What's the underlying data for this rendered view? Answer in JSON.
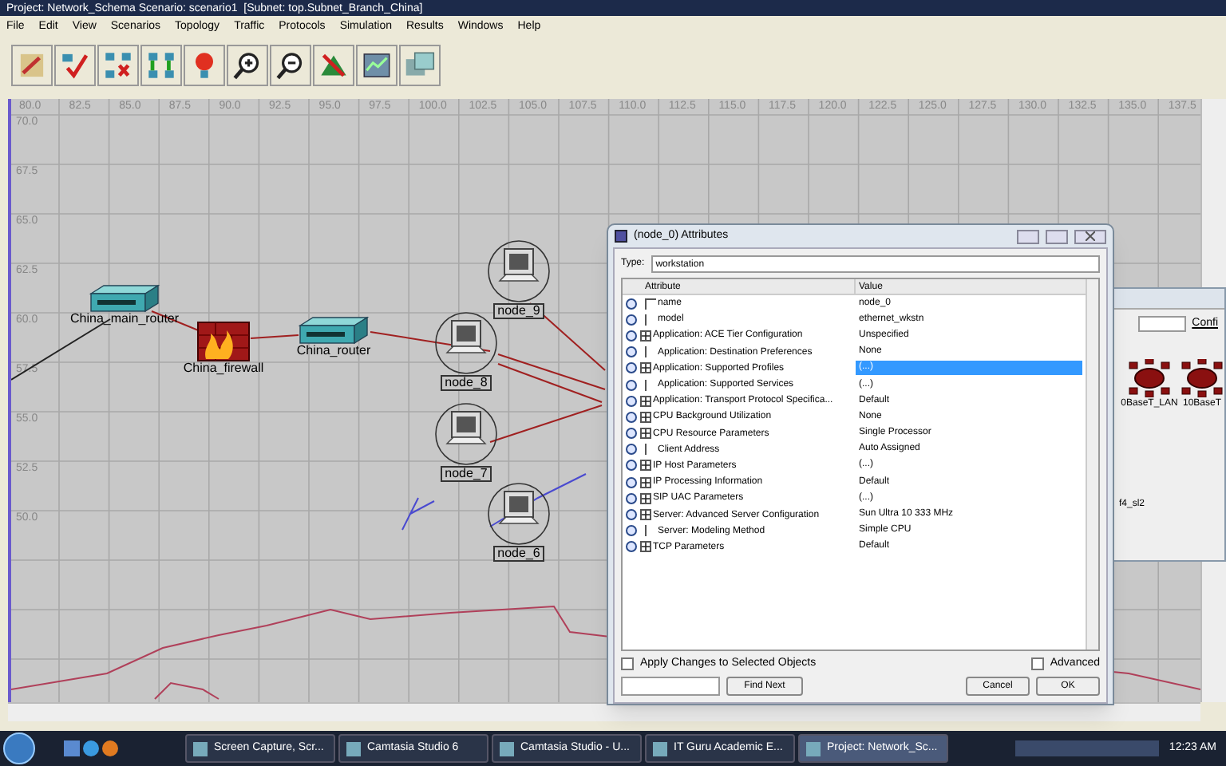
{
  "window": {
    "title": "Project: Network_Schema Scenario: scenario1  [Subnet: top.Subnet_Branch_China]"
  },
  "menu": [
    "File",
    "Edit",
    "View",
    "Scenarios",
    "Topology",
    "Traffic",
    "Protocols",
    "Simulation",
    "Results",
    "Windows",
    "Help"
  ],
  "toolbar": [
    {
      "kind": "palette"
    },
    {
      "kind": "check"
    },
    {
      "kind": "fail"
    },
    {
      "kind": "recover"
    },
    {
      "kind": "bulb"
    },
    {
      "kind": "zoom"
    },
    {
      "kind": "unzoom"
    },
    {
      "kind": "run"
    },
    {
      "kind": "results"
    },
    {
      "kind": "web"
    }
  ],
  "canvas": {
    "x_ruler": [
      "80.0",
      "82.5",
      "85.0",
      "87.5",
      "90.0",
      "92.5",
      "95.0",
      "97.5",
      "100.0",
      "102.5",
      "105.0",
      "107.5",
      "110.0",
      "112.5",
      "115.0",
      "117.5",
      "120.0",
      "122.5",
      "125.0",
      "127.5",
      "130.0",
      "132.5",
      "135.0",
      "137.5"
    ],
    "y_ruler": [
      "70.0",
      "67.5",
      "65.0",
      "62.5",
      "60.0",
      "57.5",
      "55.0",
      "52.5",
      "50.0"
    ],
    "nodes": [
      {
        "kind": "router",
        "label": "China_main_router"
      },
      {
        "kind": "firewall",
        "label": "China_firewall"
      },
      {
        "kind": "router",
        "label": "China_router"
      },
      {
        "kind": "workstation",
        "label": "node_9"
      },
      {
        "kind": "workstation",
        "label": "node_8"
      },
      {
        "kind": "workstation",
        "label": "node_7"
      },
      {
        "kind": "workstation",
        "label": "node_6"
      }
    ]
  },
  "palette_window": {
    "button": "Confi",
    "items": [
      {
        "label": "0BaseT_LAN"
      },
      {
        "label": "10BaseT"
      }
    ],
    "label_2": "f4_sl2"
  },
  "dialog": {
    "title": "(node_0) Attributes",
    "type_label": "Type:",
    "type_value": "workstation",
    "columns": [
      "Attribute",
      "Value"
    ],
    "rows": [
      {
        "kind": "first",
        "attribute": "name",
        "value": "node_0",
        "selected": false
      },
      {
        "kind": "leaf",
        "attribute": "model",
        "value": "ethernet_wkstn",
        "selected": false
      },
      {
        "kind": "group",
        "attribute": "Application: ACE Tier Configuration",
        "value": "Unspecified",
        "selected": false
      },
      {
        "kind": "leaf",
        "attribute": "Application: Destination Preferences",
        "value": "None",
        "selected": false
      },
      {
        "kind": "group",
        "attribute": "Application: Supported Profiles",
        "value": "(...)",
        "selected": true
      },
      {
        "kind": "leaf",
        "attribute": "Application: Supported Services",
        "value": "(...)",
        "selected": false
      },
      {
        "kind": "group",
        "attribute": "Application: Transport Protocol Specifica...",
        "value": "Default",
        "selected": false
      },
      {
        "kind": "group",
        "attribute": "CPU Background Utilization",
        "value": "None",
        "selected": false
      },
      {
        "kind": "group",
        "attribute": "CPU Resource Parameters",
        "value": "Single Processor",
        "selected": false
      },
      {
        "kind": "leaf",
        "attribute": "Client Address",
        "value": "Auto Assigned",
        "selected": false
      },
      {
        "kind": "group",
        "attribute": "IP Host Parameters",
        "value": "(...)",
        "selected": false
      },
      {
        "kind": "group",
        "attribute": "IP Processing Information",
        "value": "Default",
        "selected": false
      },
      {
        "kind": "group",
        "attribute": "SIP UAC Parameters",
        "value": "(...)",
        "selected": false
      },
      {
        "kind": "group",
        "attribute": "Server: Advanced Server Configuration",
        "value": "Sun Ultra 10 333 MHz",
        "selected": false
      },
      {
        "kind": "leaf",
        "attribute": "Server: Modeling Method",
        "value": "Simple CPU",
        "selected": false
      },
      {
        "kind": "group",
        "attribute": "TCP Parameters",
        "value": "Default",
        "selected": false
      }
    ],
    "apply_changes": {
      "label": "Apply Changes to Selected Objects",
      "checked": false
    },
    "advanced": {
      "label": "Advanced",
      "checked": false
    },
    "buttons": {
      "find_next": "Find Next",
      "cancel": "Cancel",
      "ok": "OK"
    }
  },
  "taskbar": {
    "items": [
      {
        "label": "Screen Capture, Scr...",
        "selected": false
      },
      {
        "label": "Camtasia Studio 6",
        "selected": false
      },
      {
        "label": "Camtasia Studio - U...",
        "selected": false
      },
      {
        "label": "IT Guru Academic E...",
        "selected": false
      },
      {
        "label": "Project: Network_Sc...",
        "selected": true
      }
    ],
    "clock": "12:23 AM"
  }
}
